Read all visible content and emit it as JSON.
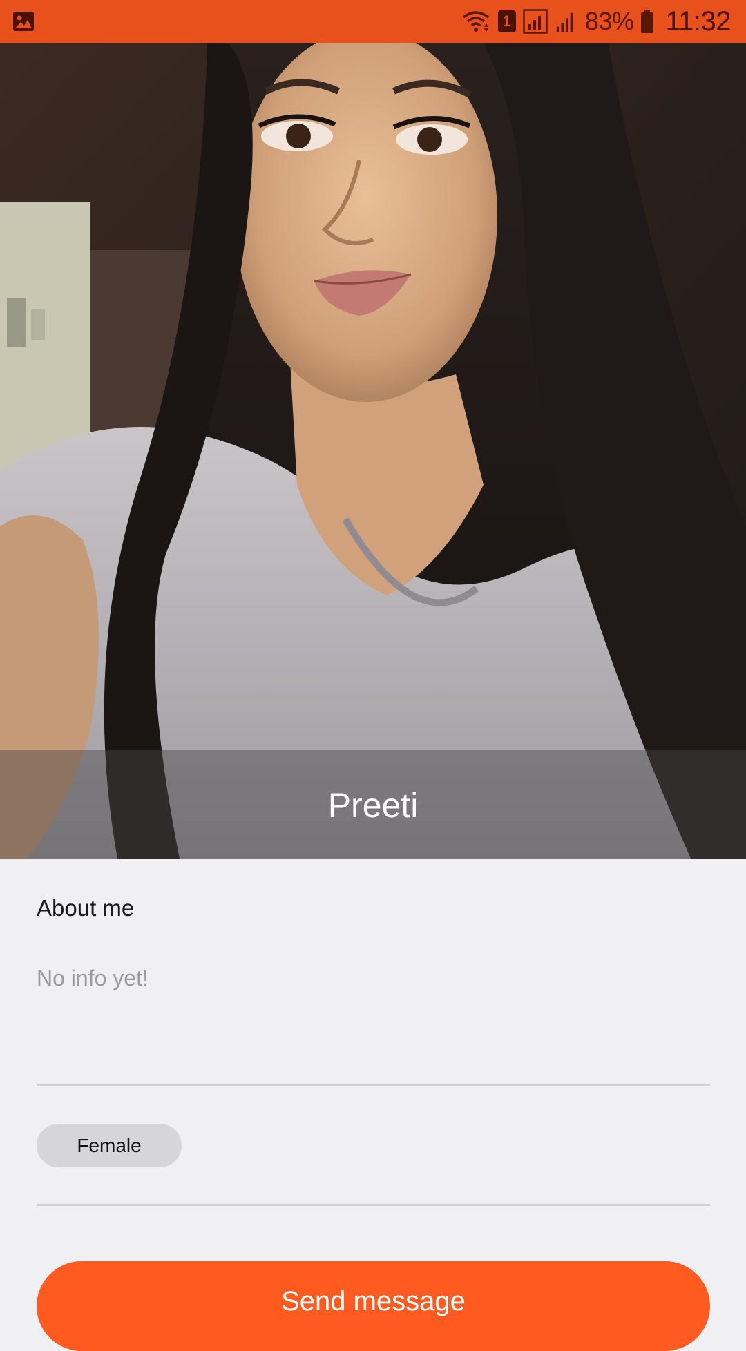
{
  "status_bar": {
    "battery_percent": "83%",
    "time": "11:32",
    "notification_badge": "1",
    "icons": [
      "gallery-icon",
      "wifi-icon",
      "sim-badge-icon",
      "signal-icon",
      "signal-icon",
      "battery-icon"
    ]
  },
  "profile": {
    "name": "Preeti",
    "about_heading": "About me",
    "about_text": "No info yet!",
    "gender": "Female"
  },
  "actions": {
    "send_label": "Send message"
  },
  "colors": {
    "accent": "#ff5a20",
    "status_bar": "#e8501c",
    "background": "#f0f0f3"
  }
}
